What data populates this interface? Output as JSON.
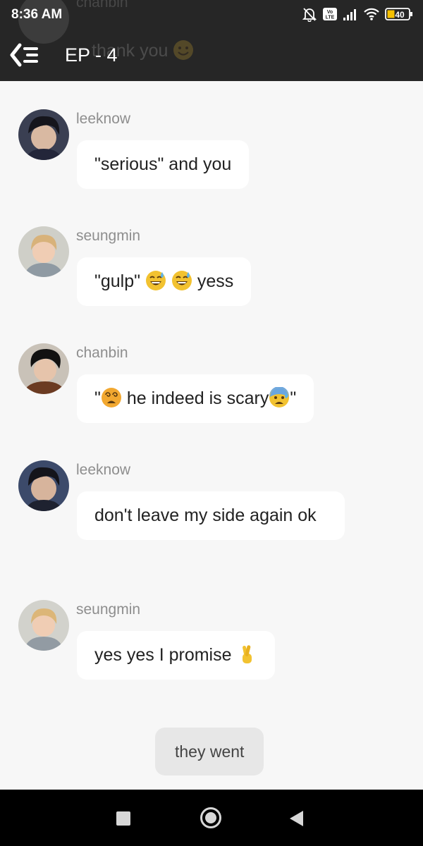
{
  "status_bar": {
    "time": "8:36 AM",
    "lte_label": "Vo LTE",
    "battery": "40",
    "icons": [
      "bell-muted-icon",
      "volte-icon",
      "signal-icon",
      "wifi-icon",
      "battery-icon"
    ]
  },
  "header": {
    "title": "EP - 4",
    "back_icon": "back-list-icon",
    "ghost": {
      "name": "chanbin",
      "message": "thank you"
    }
  },
  "messages": [
    {
      "sender": "leeknow",
      "text": "\"serious\" and you"
    },
    {
      "sender": "seungmin",
      "parts": [
        "\"gulp\" ",
        " yess"
      ],
      "emojis": [
        "sweat-smile-emoji",
        "sweat-smile-emoji"
      ]
    },
    {
      "sender": "chanbin",
      "parts": [
        "\"",
        " he indeed is scary",
        "\""
      ],
      "emojis": [
        "dizzy-face-emoji",
        "anxious-sweat-emoji"
      ]
    },
    {
      "sender": "leeknow",
      "text": "don't leave my side again ok"
    },
    {
      "sender": "seungmin",
      "text": "yes yes I promise ",
      "emojis": [
        "crossed-fingers-emoji"
      ]
    }
  ],
  "narration": "they went",
  "nav": {
    "recents": "recents-button",
    "home": "home-button",
    "back": "back-button"
  },
  "colors": {
    "header_bg": "#262626",
    "chat_bg": "#f7f7f7",
    "bubble_bg": "#ffffff",
    "narration_bg": "#e7e7e7",
    "name_text": "#8e8e8e"
  }
}
